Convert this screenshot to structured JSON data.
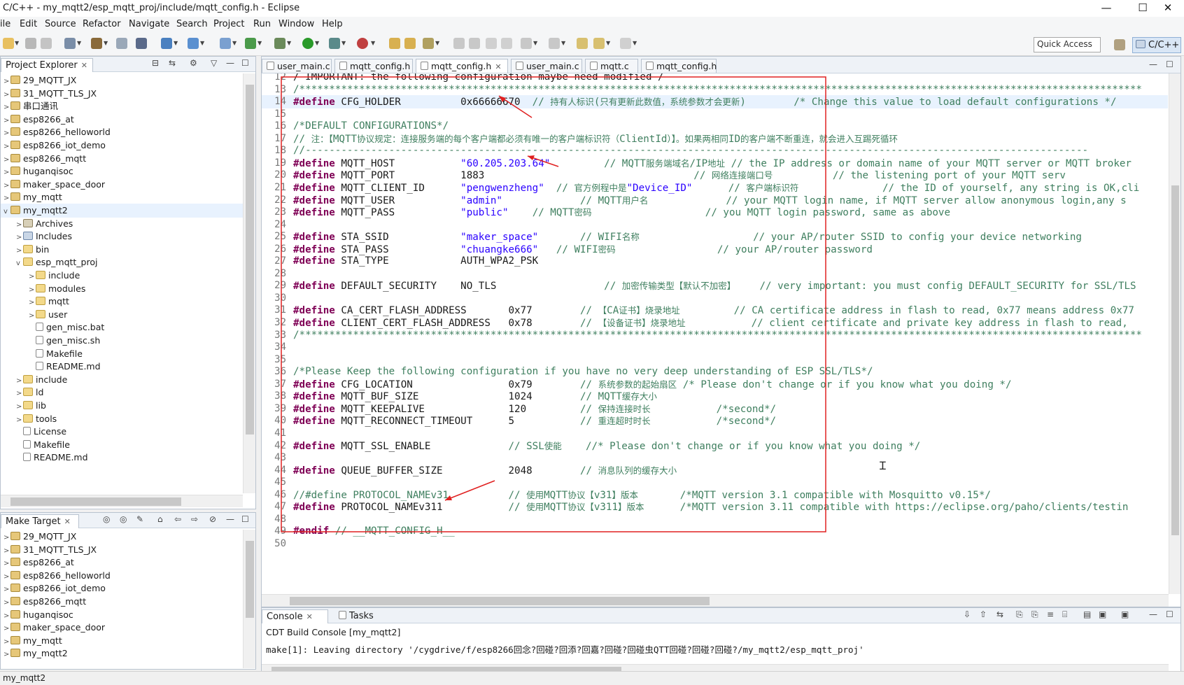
{
  "window": {
    "title": "C/C++ - my_mqtt2/esp_mqtt_proj/include/mqtt_config.h - Eclipse",
    "minimize": "—",
    "maximize": "☐",
    "close": "✕"
  },
  "menu": [
    "ile",
    "Edit",
    "Source",
    "Refactor",
    "Navigate",
    "Search",
    "Project",
    "Run",
    "Window",
    "Help"
  ],
  "toolbar": {
    "quick_access": "Quick Access",
    "perspective": "C/C++"
  },
  "project_explorer": {
    "title": "Project Explorer",
    "items": [
      {
        "label": "29_MQTT_JX"
      },
      {
        "label": "31_MQTT_TLS_JX"
      },
      {
        "label": "串口通讯"
      },
      {
        "label": "esp8266_at"
      },
      {
        "label": "esp8266_helloworld"
      },
      {
        "label": "esp8266_iot_demo"
      },
      {
        "label": "esp8266_mqtt"
      },
      {
        "label": "huganqisoc"
      },
      {
        "label": "maker_space_door"
      },
      {
        "label": "my_mqtt"
      },
      {
        "label": "my_mqtt2"
      },
      {
        "label": "Archives"
      },
      {
        "label": "Includes"
      },
      {
        "label": "bin"
      },
      {
        "label": "esp_mqtt_proj"
      },
      {
        "label": "include"
      },
      {
        "label": "modules"
      },
      {
        "label": "mqtt"
      },
      {
        "label": "user"
      },
      {
        "label": "gen_misc.bat"
      },
      {
        "label": "gen_misc.sh"
      },
      {
        "label": "Makefile"
      },
      {
        "label": "README.md"
      },
      {
        "label": "include"
      },
      {
        "label": "ld"
      },
      {
        "label": "lib"
      },
      {
        "label": "tools"
      },
      {
        "label": "License"
      },
      {
        "label": "Makefile"
      },
      {
        "label": "README.md"
      }
    ]
  },
  "make_target": {
    "title": "Make Target",
    "items": [
      {
        "label": "29_MQTT_JX"
      },
      {
        "label": "31_MQTT_TLS_JX"
      },
      {
        "label": "esp8266_at"
      },
      {
        "label": "esp8266_helloworld"
      },
      {
        "label": "esp8266_iot_demo"
      },
      {
        "label": "esp8266_mqtt"
      },
      {
        "label": "huganqisoc"
      },
      {
        "label": "maker_space_door"
      },
      {
        "label": "my_mqtt"
      },
      {
        "label": "my_mqtt2"
      }
    ]
  },
  "editor": {
    "tabs": [
      "user_main.c",
      "mqtt_config.h",
      "mqtt_config.h",
      "user_main.c",
      "mqtt.c",
      "mqtt_config.h"
    ],
    "lines": [
      {
        "n": "12",
        "t": "/ IMPORTANT: the following configuration maybe need modified /"
      },
      {
        "n": "13",
        "t": "/*********************************************************************************************************************************************"
      },
      {
        "n": "14",
        "t": "#define CFG_HOLDER          0x66666670  // 持有人标识(只有更新此数值，系统参数才会更新)        /* Change this value to load default configurations */"
      },
      {
        "n": "15",
        "t": ""
      },
      {
        "n": "16",
        "t": "/*DEFAULT CONFIGURATIONS*/"
      },
      {
        "n": "17",
        "t": "// 注：【MQTT协议规定：连接服务端的每个客户端都必须有唯一的客户端标识符（ClientId）】。如果两相同ID的客户端不断重连，就会进入互踢死循环"
      },
      {
        "n": "18",
        "t": "//-----------------------------------------------------------------------------------------------------------------------------------"
      },
      {
        "n": "19",
        "t": "#define MQTT_HOST           \"60.205.203.64\"         // MQTT服务端域名/IP地址 // the IP address or domain name of your MQTT server or MQTT broker"
      },
      {
        "n": "20",
        "t": "#define MQTT_PORT           1883                                   // 网络连接端口号          // the listening port of your MQTT serv"
      },
      {
        "n": "21",
        "t": "#define MQTT_CLIENT_ID      \"pengwenzheng\"  // 官方例程中是\"Device_ID\"      // 客户端标识符              // the ID of yourself, any string is OK,cli"
      },
      {
        "n": "22",
        "t": "#define MQTT_USER           \"admin\"             // MQTT用户名             // your MQTT login name, if MQTT server allow anonymous login,any s"
      },
      {
        "n": "23",
        "t": "#define MQTT_PASS           \"public\"    // MQTT密码                   // you MQTT login password, same as above"
      },
      {
        "n": "24",
        "t": ""
      },
      {
        "n": "25",
        "t": "#define STA_SSID            \"maker_space\"       // WIFI名称                   // your AP/router SSID to config your device networking"
      },
      {
        "n": "26",
        "t": "#define STA_PASS            \"chuangke666\"   // WIFI密码                 // your AP/router password"
      },
      {
        "n": "27",
        "t": "#define STA_TYPE            AUTH_WPA2_PSK"
      },
      {
        "n": "28",
        "t": ""
      },
      {
        "n": "29",
        "t": "#define DEFAULT_SECURITY    NO_TLS                  // 加密传输类型【默认不加密】    // very important: you must config DEFAULT_SECURITY for SSL/TLS"
      },
      {
        "n": "30",
        "t": ""
      },
      {
        "n": "31",
        "t": "#define CA_CERT_FLASH_ADDRESS       0x77        // 【CA证书】烧录地址         // CA certificate address in flash to read, 0x77 means address 0x77"
      },
      {
        "n": "32",
        "t": "#define CLIENT_CERT_FLASH_ADDRESS   0x78        // 【设备证书】烧录地址           // client certificate and private key address in flash to read,"
      },
      {
        "n": "33",
        "t": "/*********************************************************************************************************************************************"
      },
      {
        "n": "34",
        "t": ""
      },
      {
        "n": "35",
        "t": ""
      },
      {
        "n": "36",
        "t": "/*Please Keep the following configuration if you have no very deep understanding of ESP SSL/TLS*/"
      },
      {
        "n": "37",
        "t": "#define CFG_LOCATION                0x79        // 系统参数的起始扇区 /* Please don't change or if you know what you doing */"
      },
      {
        "n": "38",
        "t": "#define MQTT_BUF_SIZE               1024        // MQTT缓存大小"
      },
      {
        "n": "39",
        "t": "#define MQTT_KEEPALIVE              120         // 保持连接时长           /*second*/"
      },
      {
        "n": "40",
        "t": "#define MQTT_RECONNECT_TIMEOUT      5           // 重连超时时长           /*second*/"
      },
      {
        "n": "41",
        "t": ""
      },
      {
        "n": "42",
        "t": "#define MQTT_SSL_ENABLE             // SSL使能    //* Please don't change or if you know what you doing */"
      },
      {
        "n": "43",
        "t": ""
      },
      {
        "n": "44",
        "t": "#define QUEUE_BUFFER_SIZE           2048        // 消息队列的缓存大小"
      },
      {
        "n": "45",
        "t": ""
      },
      {
        "n": "46",
        "t": "//#define PROTOCOL_NAMEv31          // 使用MQTT协议【v31】版本       /*MQTT version 3.1 compatible with Mosquitto v0.15*/"
      },
      {
        "n": "47",
        "t": "#define PROTOCOL_NAMEv311           // 使用MQTT协议【v311】版本      /*MQTT version 3.11 compatible with https://eclipse.org/paho/clients/testin"
      },
      {
        "n": "48",
        "t": ""
      },
      {
        "n": "49",
        "t": "#endif // __MQTT_CONFIG_H__"
      },
      {
        "n": "50",
        "t": ""
      }
    ]
  },
  "console": {
    "tabs": [
      "Console",
      "Tasks"
    ],
    "title": "CDT Build Console [my_mqtt2]",
    "output": "make[1]: Leaving directory '/cygdrive/f/esp8266回念?回碰?回添?回嘉?回碰?回碰虫QTT回碰?回碰?回碰?/my_mqtt2/esp_mqtt_proj'"
  },
  "statusbar": {
    "text": "my_mqtt2"
  },
  "colors": {
    "annotation_red": "#e02020",
    "keyword": "#7f0055",
    "string": "#2a00ff",
    "comment": "#3f7f5f"
  }
}
